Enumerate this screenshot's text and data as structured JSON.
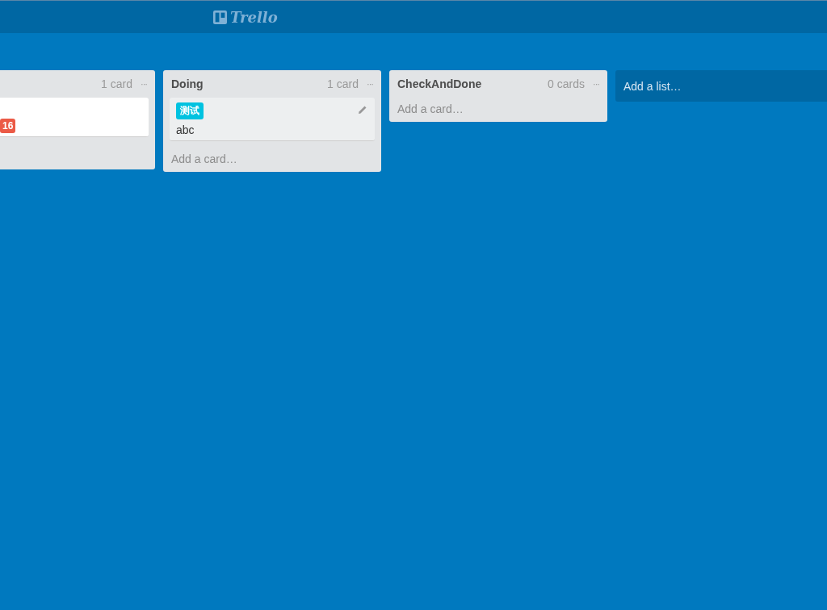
{
  "header": {
    "logo": "Trello"
  },
  "lists": [
    {
      "count": "1 card",
      "menu": "···",
      "cards": [
        {
          "badges": [
            {
              "text": "16",
              "color": "#eb5a46"
            }
          ],
          "editable": false
        }
      ]
    },
    {
      "title": "Doing",
      "count": "1 card",
      "menu": "···",
      "cards": [
        {
          "labels": [
            {
              "text": "测试",
              "color": "#00c2e0"
            }
          ],
          "title": "abc",
          "editable": true
        }
      ],
      "add_card": "Add a card…"
    },
    {
      "title": "CheckAndDone",
      "count": "0 cards",
      "menu": "···",
      "add_card": "Add a card…"
    }
  ],
  "add_list": "Add a list…"
}
